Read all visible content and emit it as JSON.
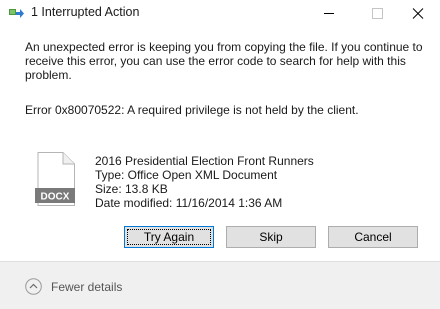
{
  "window": {
    "title": "1 Interrupted Action",
    "icon": "file-copy-icon"
  },
  "dialog": {
    "message": "An unexpected error is keeping you from copying the file. If you continue to receive this error, you can use the error code to search for help with this problem.",
    "error": "Error 0x80070522: A required privilege is not held by the client."
  },
  "file": {
    "icon": "docx-file-icon",
    "icon_label": "DOCX",
    "name": "2016 Presidential Election Front Runners",
    "type": "Type: Office Open XML Document",
    "size": "Size: 13.8 KB",
    "date_modified": "Date modified: 11/16/2014 1:36 AM"
  },
  "buttons": {
    "try_again": "Try Again",
    "skip": "Skip",
    "cancel": "Cancel"
  },
  "footer": {
    "details_toggle": "Fewer details",
    "icon": "chevron-up-icon"
  },
  "colors": {
    "accent_border": "#0078d7",
    "footer_bg": "#f0f0f0",
    "button_bg": "#e1e1e1"
  }
}
